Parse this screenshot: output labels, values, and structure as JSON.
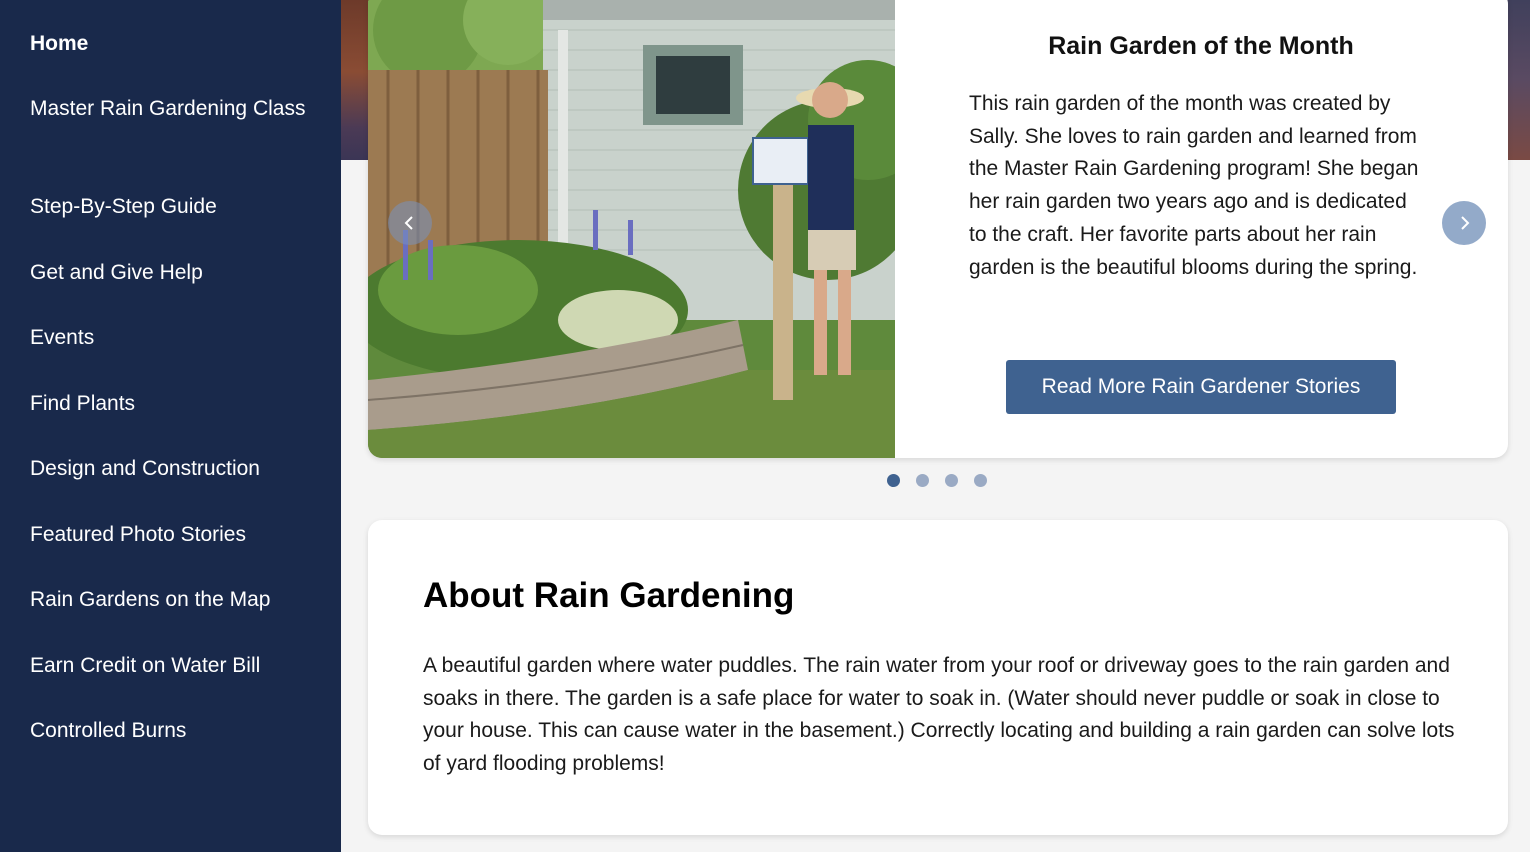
{
  "sidebar": {
    "items": [
      {
        "label": "Home",
        "active": true
      },
      {
        "label": "Master Rain Gardening Class",
        "active": false
      },
      {
        "label": "Step-By-Step Guide",
        "active": false
      },
      {
        "label": "Get and Give Help",
        "active": false
      },
      {
        "label": "Events",
        "active": false
      },
      {
        "label": "Find Plants",
        "active": false
      },
      {
        "label": "Design and Construction",
        "active": false
      },
      {
        "label": "Featured Photo Stories",
        "active": false
      },
      {
        "label": "Rain Gardens on the Map",
        "active": false
      },
      {
        "label": "Earn Credit on Water Bill",
        "active": false
      },
      {
        "label": "Controlled Burns",
        "active": false
      }
    ]
  },
  "carousel": {
    "title": "Rain Garden of the Month",
    "text": "This rain garden of the month was created by Sally. She loves to rain garden and learned from the Master Rain Gardening program! She began her rain garden two years ago and is dedicated to the craft. Her favorite parts about her rain garden is the beautiful blooms during the spring.",
    "button_label": "Read More Rain Gardener Stories",
    "slide_count": 4,
    "active_slide": 1,
    "icons": {
      "prev": "chevron-left-icon",
      "next": "chevron-right-icon"
    }
  },
  "about": {
    "title": "About Rain Gardening",
    "text": "A beautiful garden where water puddles. The rain water from your roof or driveway goes to the rain garden and soaks in there. The garden is a safe place for water to soak in. (Water should never puddle or soak in close to your house. This can cause water in the basement.) Correctly locating and building a rain garden can solve lots of yard flooding problems!"
  },
  "colors": {
    "sidebar_bg": "#19294b",
    "accent": "#3f6290",
    "page_bg": "#f4f4f4"
  }
}
